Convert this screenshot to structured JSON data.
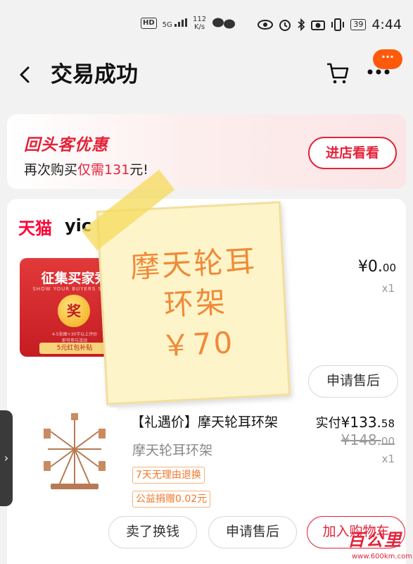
{
  "status_bar": {
    "network_badge": "HD",
    "signal": "5G",
    "speed_value": "112",
    "speed_unit": "K/s",
    "battery": "39",
    "time": "4:44"
  },
  "nav": {
    "title": "交易成功",
    "message_badge": "···"
  },
  "promo": {
    "title": "回头客优惠",
    "desc_prefix": "再次购买",
    "desc_highlight": "仅需131",
    "desc_suffix": "元!",
    "button": "进店看看"
  },
  "shop": {
    "logo": "天猫",
    "name": "yic"
  },
  "item1": {
    "image_title": "征集买家秀",
    "image_subtitle": "SHOW YOUR BUYERS SHOW",
    "image_coin": "奖",
    "image_lines": [
      "4-5张图+30字以上评价",
      "即可参与活动"
    ],
    "image_tag": "5元红包补贴",
    "price_main": "¥0.",
    "price_decimal": "00",
    "qty": "x1",
    "after_sale_button": "申请售后"
  },
  "sticky_note": {
    "line1": "摩天轮耳",
    "line2": "环架",
    "line3": "￥70"
  },
  "item2": {
    "title": "【礼遇价】摩天轮耳环架",
    "sku": "摩天轮耳环架",
    "tag1": "7天无理由退换",
    "tag2": "公益捐赠0.02元",
    "paid_label": "实付",
    "paid_main": "¥133.",
    "paid_decimal": "58",
    "orig_main": "¥148.",
    "orig_decimal": "00",
    "qty": "x1"
  },
  "actions": {
    "sell": "卖了换钱",
    "after_sale": "申请售后",
    "add_to_cart": "加入购物车"
  },
  "side_tab": {
    "glyph": "›"
  },
  "watermark": {
    "text": "百公里",
    "url": "www.600km.com"
  },
  "colors": {
    "accent_red": "#e3233a",
    "tmall_red": "#ff0036",
    "sticky_orange": "#f08a3a",
    "badge_orange": "#ff5a0a"
  }
}
